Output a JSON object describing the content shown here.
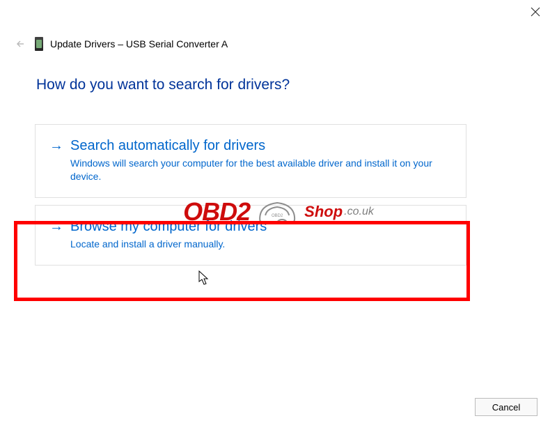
{
  "window": {
    "title": "Update Drivers – USB Serial Converter A"
  },
  "heading": "How do you want to search for drivers?",
  "options": [
    {
      "title": "Search automatically for drivers",
      "desc": "Windows will search your computer for the best available driver and install it on your device."
    },
    {
      "title": "Browse my computer for drivers",
      "desc": "Locate and install a driver manually."
    }
  ],
  "buttons": {
    "cancel": "Cancel"
  },
  "watermark": {
    "brand": "OBD2",
    "suffix1": "Shop",
    "suffix2": ".co.uk"
  }
}
